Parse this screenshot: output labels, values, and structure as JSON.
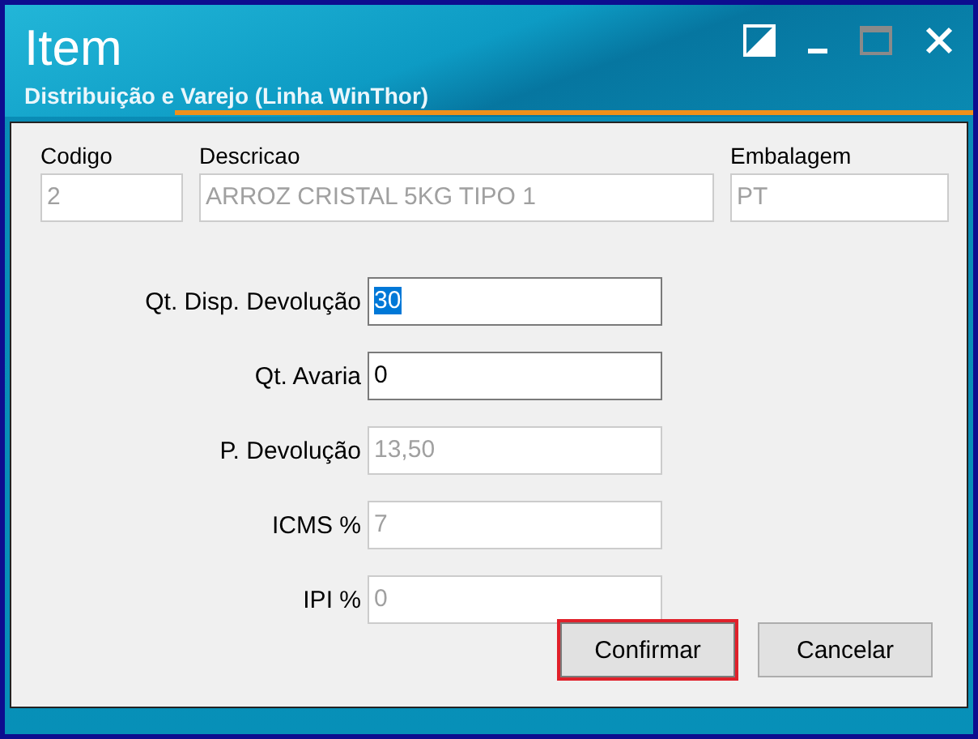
{
  "window": {
    "title": "Item",
    "subtitle": "Distribuição e Varejo (Linha WinThor)"
  },
  "window_controls": [
    {
      "kind": "contrast",
      "disabled": false
    },
    {
      "kind": "minimize",
      "disabled": false
    },
    {
      "kind": "maximize",
      "disabled": true
    },
    {
      "kind": "close",
      "disabled": false
    }
  ],
  "header_fields": [
    {
      "label": "Codigo",
      "value": "2",
      "disabled": true
    },
    {
      "label": "Descricao",
      "value": "ARROZ CRISTAL 5KG TIPO 1",
      "disabled": true
    },
    {
      "label": "Embalagem",
      "value": "PT",
      "disabled": true
    }
  ],
  "form_fields": [
    {
      "label": "Qt. Disp. Devolução",
      "value": "30",
      "disabled": false,
      "selected": true
    },
    {
      "label": "Qt. Avaria",
      "value": "0",
      "disabled": false,
      "selected": false
    },
    {
      "label": "P. Devolução",
      "value": "13,50",
      "disabled": true,
      "selected": false
    },
    {
      "label": "ICMS %",
      "value": "7",
      "disabled": true,
      "selected": false
    },
    {
      "label": "IPI %",
      "value": "0",
      "disabled": true,
      "selected": false
    }
  ],
  "buttons": [
    {
      "label": "Confirmar",
      "highlighted": true
    },
    {
      "label": "Cancelar",
      "highlighted": false
    }
  ]
}
